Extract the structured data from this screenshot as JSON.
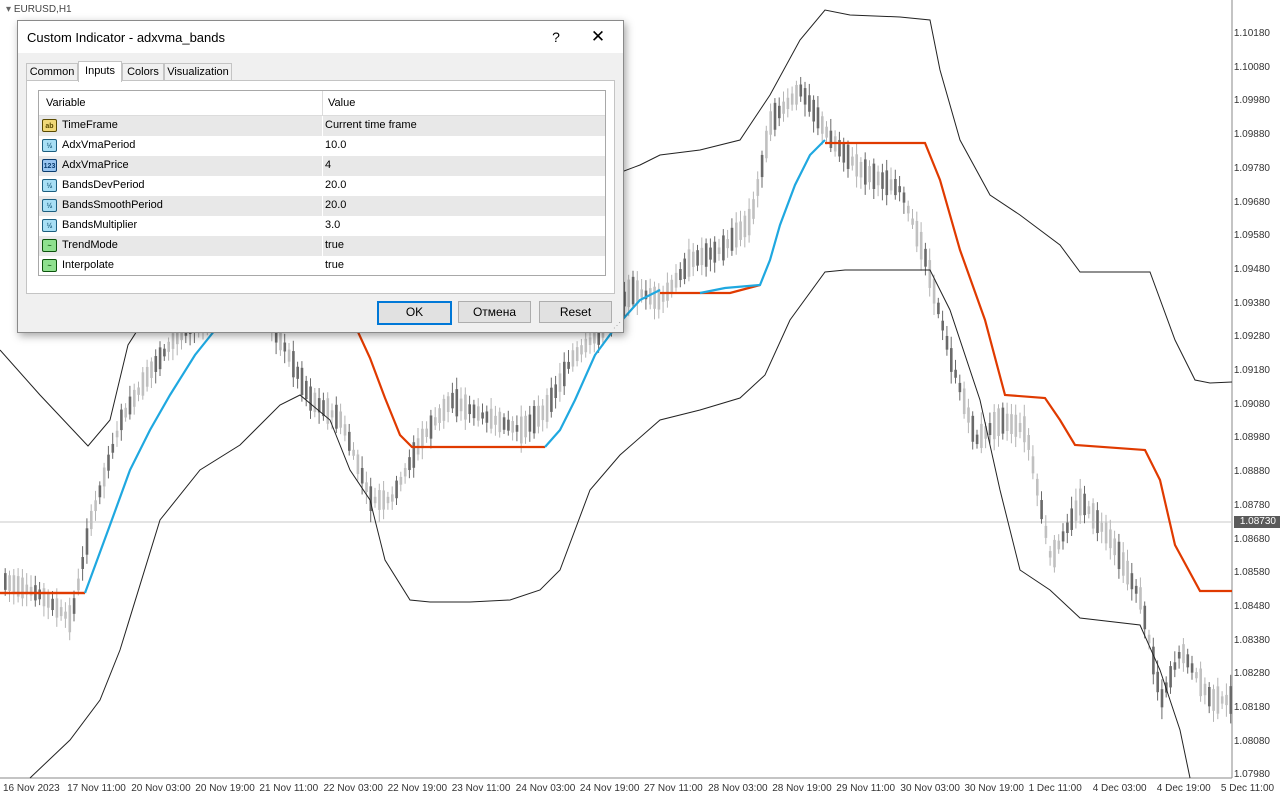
{
  "chart": {
    "symbol": "EURUSD,H1",
    "price_labels": [
      "1.10180",
      "1.10080",
      "1.09980",
      "1.09880",
      "1.09780",
      "1.09680",
      "1.09580",
      "1.09480",
      "1.09380",
      "1.09280",
      "1.09180",
      "1.09080",
      "1.08980",
      "1.08880",
      "1.08780",
      "1.08680",
      "1.08580",
      "1.08480",
      "1.08380",
      "1.08280",
      "1.08180",
      "1.08080",
      "1.07980"
    ],
    "current_price": "1.08730",
    "date_labels": [
      "16 Nov 2023",
      "17 Nov 11:00",
      "20 Nov 03:00",
      "20 Nov 19:00",
      "21 Nov 11:00",
      "22 Nov 03:00",
      "22 Nov 19:00",
      "23 Nov 11:00",
      "24 Nov 03:00",
      "24 Nov 19:00",
      "27 Nov 11:00",
      "28 Nov 03:00",
      "28 Nov 19:00",
      "29 Nov 11:00",
      "30 Nov 03:00",
      "30 Nov 19:00",
      "1 Dec 11:00",
      "4 Dec 03:00",
      "4 Dec 19:00",
      "5 Dec 11:00"
    ],
    "colors": {
      "uptrend": "#1fa8e0",
      "downtrend": "#e03a00",
      "bands": "#222222",
      "candles": "#8c8c8c"
    }
  },
  "dialog": {
    "title": "Custom Indicator - adxvma_bands",
    "help_label": "?",
    "close_label": "✕",
    "tabs": [
      {
        "label": "Common"
      },
      {
        "label": "Inputs"
      },
      {
        "label": "Colors"
      },
      {
        "label": "Visualization"
      }
    ],
    "active_tab": "Inputs",
    "columns": {
      "variable": "Variable",
      "value": "Value"
    },
    "rows": [
      {
        "icon": "ab",
        "variable": "TimeFrame",
        "value": "Current time frame"
      },
      {
        "icon": "½",
        "variable": "AdxVmaPeriod",
        "value": "10.0"
      },
      {
        "icon": "123",
        "variable": "AdxVmaPrice",
        "value": "4"
      },
      {
        "icon": "½",
        "variable": "BandsDevPeriod",
        "value": "20.0"
      },
      {
        "icon": "½",
        "variable": "BandsSmoothPeriod",
        "value": "20.0"
      },
      {
        "icon": "½",
        "variable": "BandsMultiplier",
        "value": "3.0"
      },
      {
        "icon": "~",
        "variable": "TrendMode",
        "value": "true"
      },
      {
        "icon": "~",
        "variable": "Interpolate",
        "value": "true"
      }
    ],
    "buttons": {
      "ok": "OK",
      "cancel": "Отмена",
      "reset": "Reset"
    }
  }
}
